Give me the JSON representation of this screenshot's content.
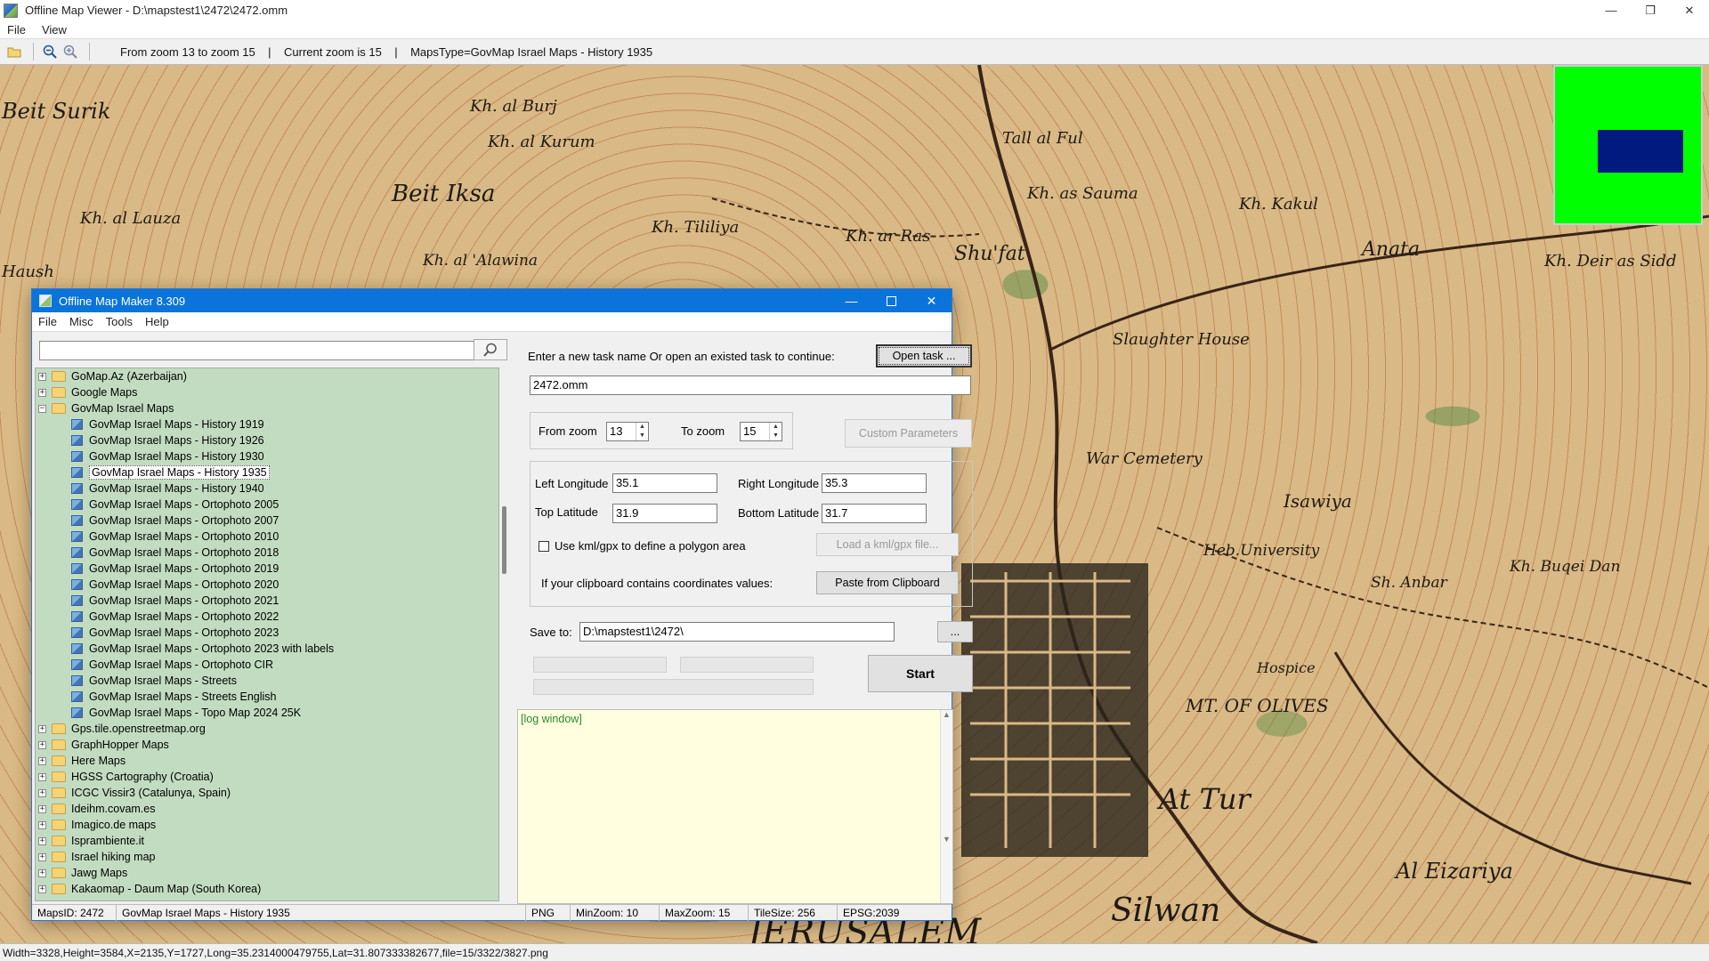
{
  "window": {
    "title": "Offline Map Viewer - D:\\mapstest1\\2472\\2472.omm",
    "minimize": "—",
    "maximize": "❐",
    "close": "✕"
  },
  "menu": {
    "file": "File",
    "view": "View"
  },
  "toolbar": {
    "status": "From zoom 13 to zoom 15    |    Current zoom is 15    |    MapsType=GovMap Israel Maps - History 1935"
  },
  "map": {
    "labels": [
      {
        "text": "Beit Surik",
        "size": 24
      },
      {
        "text": "Kh. al Burj",
        "size": 18
      },
      {
        "text": "Kh. al Kurum",
        "size": 18
      },
      {
        "text": "Beit Iksa",
        "size": 26
      },
      {
        "text": "Kh. al Lauza",
        "size": 18
      },
      {
        "text": "Kh. Tililiya",
        "size": 18
      },
      {
        "text": "Kh. ar Ras",
        "size": 18
      },
      {
        "text": "Tall al Ful",
        "size": 18
      },
      {
        "text": "Kh. as Sauma",
        "size": 18
      },
      {
        "text": "Kh. Kakul",
        "size": 18
      },
      {
        "text": "Anata",
        "size": 22
      },
      {
        "text": "Kh. Deir as Sidd",
        "size": 18
      },
      {
        "text": "Shu'fat",
        "size": 22
      },
      {
        "text": "Kh. al 'Alawina",
        "size": 17
      },
      {
        "text": "Haush",
        "size": 18
      },
      {
        "text": "Slaughter House",
        "size": 18
      },
      {
        "text": "War Cemetery",
        "size": 18
      },
      {
        "text": "Isawiya",
        "size": 20
      },
      {
        "text": "Heb.University",
        "size": 17
      },
      {
        "text": "Kh. Buqei Dan",
        "size": 17
      },
      {
        "text": "Sh. Anbar",
        "size": 17
      },
      {
        "text": "Hospice",
        "size": 16
      },
      {
        "text": "MT. OF OLIVES",
        "size": 20
      },
      {
        "text": "At Tur",
        "size": 32
      },
      {
        "text": "Al Eizariya",
        "size": 24
      },
      {
        "text": "Silwan",
        "size": 36
      },
      {
        "text": "JERUSALEM",
        "size": 40
      }
    ]
  },
  "statusbar": {
    "text": "Width=3328,Height=3584,X=2135,Y=1727,Long=35.2314000479755,Lat=31.807333382677,file=15/3322/3827.png"
  },
  "dialog": {
    "title": "Offline Map Maker 8.309",
    "menu": [
      "File",
      "Misc",
      "Tools",
      "Help"
    ],
    "search_value": "",
    "tree": [
      {
        "type": "folder",
        "label": "GoMap.Az (Azerbaijan)",
        "exp": "+"
      },
      {
        "type": "folder",
        "label": "Google Maps",
        "exp": "+"
      },
      {
        "type": "folder",
        "label": "GovMap Israel Maps",
        "exp": "−"
      },
      {
        "type": "map",
        "label": "GovMap Israel Maps - History 1919"
      },
      {
        "type": "map",
        "label": "GovMap Israel Maps - History 1926"
      },
      {
        "type": "map",
        "label": "GovMap Israel Maps - History 1930"
      },
      {
        "type": "map",
        "label": "GovMap Israel Maps - History 1935",
        "selected": true
      },
      {
        "type": "map",
        "label": "GovMap Israel Maps - History 1940"
      },
      {
        "type": "map",
        "label": "GovMap Israel Maps - Ortophoto 2005"
      },
      {
        "type": "map",
        "label": "GovMap Israel Maps - Ortophoto 2007"
      },
      {
        "type": "map",
        "label": "GovMap Israel Maps - Ortophoto 2010"
      },
      {
        "type": "map",
        "label": "GovMap Israel Maps - Ortophoto 2018"
      },
      {
        "type": "map",
        "label": "GovMap Israel Maps - Ortophoto 2019"
      },
      {
        "type": "map",
        "label": "GovMap Israel Maps - Ortophoto 2020"
      },
      {
        "type": "map",
        "label": "GovMap Israel Maps - Ortophoto 2021"
      },
      {
        "type": "map",
        "label": "GovMap Israel Maps - Ortophoto 2022"
      },
      {
        "type": "map",
        "label": "GovMap Israel Maps - Ortophoto 2023"
      },
      {
        "type": "map",
        "label": "GovMap Israel Maps - Ortophoto 2023 with labels"
      },
      {
        "type": "map",
        "label": "GovMap Israel Maps - Ortophoto CIR"
      },
      {
        "type": "map",
        "label": "GovMap Israel Maps - Streets"
      },
      {
        "type": "map",
        "label": "GovMap Israel Maps - Streets English"
      },
      {
        "type": "map",
        "label": "GovMap Israel Maps - Topo Map 2024 25K"
      },
      {
        "type": "folder",
        "label": "Gps.tile.openstreetmap.org",
        "exp": "+"
      },
      {
        "type": "folder",
        "label": "GraphHopper Maps",
        "exp": "+"
      },
      {
        "type": "folder",
        "label": "Here Maps",
        "exp": "+"
      },
      {
        "type": "folder",
        "label": "HGSS Cartography (Croatia)",
        "exp": "+"
      },
      {
        "type": "folder",
        "label": "ICGC Vissir3 (Catalunya, Spain)",
        "exp": "+"
      },
      {
        "type": "folder",
        "label": "Ideihm.covam.es",
        "exp": "+"
      },
      {
        "type": "folder",
        "label": "Imagico.de maps",
        "exp": "+"
      },
      {
        "type": "folder",
        "label": "Isprambiente.it",
        "exp": "+"
      },
      {
        "type": "folder",
        "label": "Israel hiking map",
        "exp": "+"
      },
      {
        "type": "folder",
        "label": "Jawg Maps",
        "exp": "+"
      },
      {
        "type": "folder",
        "label": "Kakaomap - Daum Map (South Korea)",
        "exp": "+"
      }
    ],
    "task_prompt": "Enter a new task name Or open an existed task to continue:",
    "open_task": "Open task ...",
    "task_name": "2472.omm",
    "from_zoom_label": "From zoom",
    "from_zoom": "13",
    "to_zoom_label": "To zoom",
    "to_zoom": "15",
    "custom_params": "Custom Parameters",
    "left_lon_label": "Left Longitude",
    "left_lon": "35.1",
    "right_lon_label": "Right Longitude",
    "right_lon": "35.3",
    "top_lat_label": "Top Latitude",
    "top_lat": "31.9",
    "bottom_lat_label": "Bottom Latitude",
    "bottom_lat": "31.7",
    "kml_label": "Use kml/gpx to define a polygon area",
    "load_kml": "Load a kml/gpx file...",
    "clipboard_label": "If your clipboard contains coordinates values:",
    "paste_clipboard": "Paste from Clipboard",
    "save_to_label": "Save to:",
    "save_to": "D:\\mapstest1\\2472\\",
    "browse": "...",
    "start": "Start",
    "log": "[log window]",
    "status": {
      "maps_id": "MapsID: 2472",
      "map_name": "GovMap Israel Maps - History 1935",
      "format": "PNG",
      "min_zoom": "MinZoom: 10",
      "max_zoom": "MaxZoom: 15",
      "tile_size": "TileSize: 256",
      "epsg": "EPSG:2039"
    }
  }
}
